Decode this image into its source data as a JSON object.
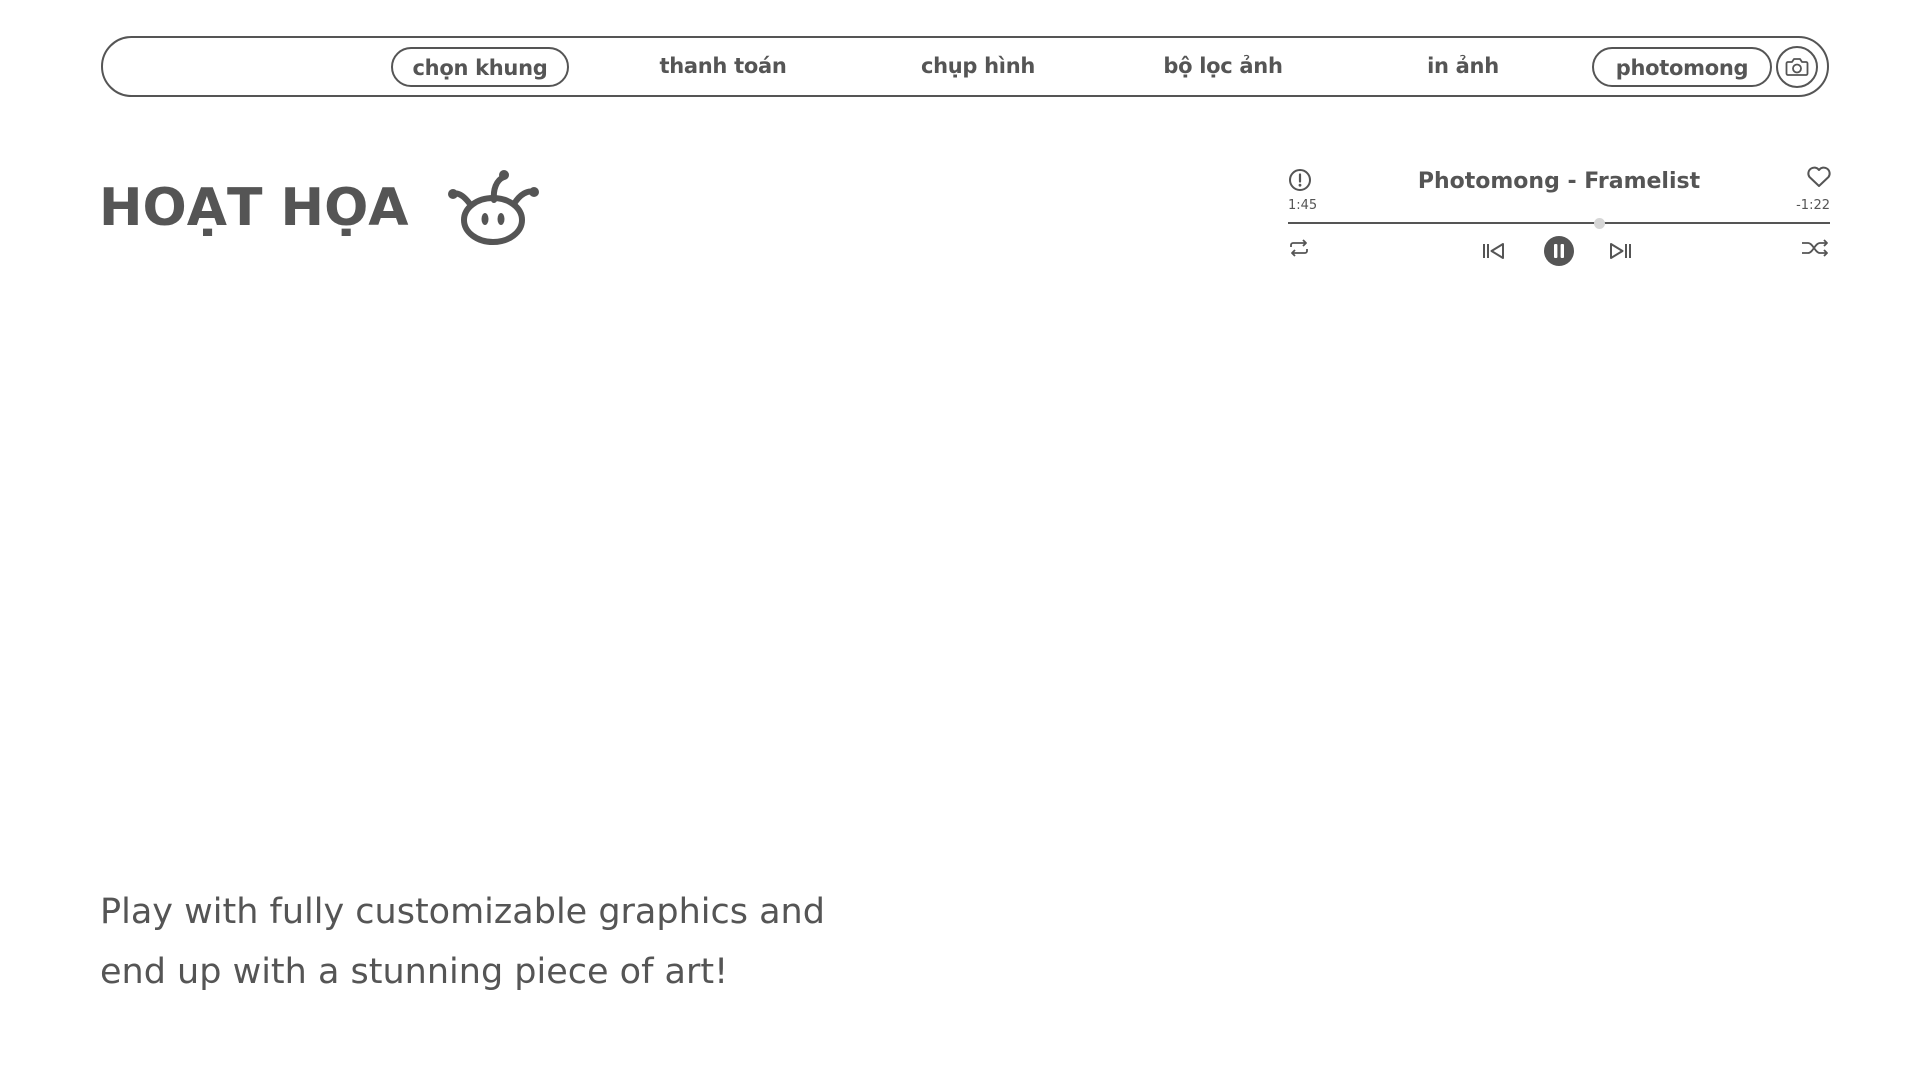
{
  "nav": {
    "items": [
      {
        "label": "chọn khung",
        "active": true
      },
      {
        "label": "thanh toán",
        "active": false
      },
      {
        "label": "chụp hình",
        "active": false
      },
      {
        "label": "bộ lọc ảnh",
        "active": false
      },
      {
        "label": "in ảnh",
        "active": false
      }
    ],
    "brand_button": "photomong",
    "camera_icon": "camera-icon"
  },
  "logo": {
    "text": "HOẠT HỌA",
    "icon": "jester-mascot-icon"
  },
  "player": {
    "title": "Photomong - Framelist",
    "elapsed": "1:45",
    "remaining": "-1:22",
    "progress": 0.575,
    "state": "playing",
    "icons": [
      "info-icon",
      "heart-icon",
      "repeat-icon",
      "previous-icon",
      "pause-icon",
      "next-icon",
      "shuffle-icon"
    ]
  },
  "tagline": {
    "line1": "Play with fully customizable graphics and",
    "line2": "end up with a stunning piece of art!"
  },
  "colors": {
    "primary": "#555555",
    "background": "#ffffff",
    "progress_knob": "#d6d6d6"
  }
}
